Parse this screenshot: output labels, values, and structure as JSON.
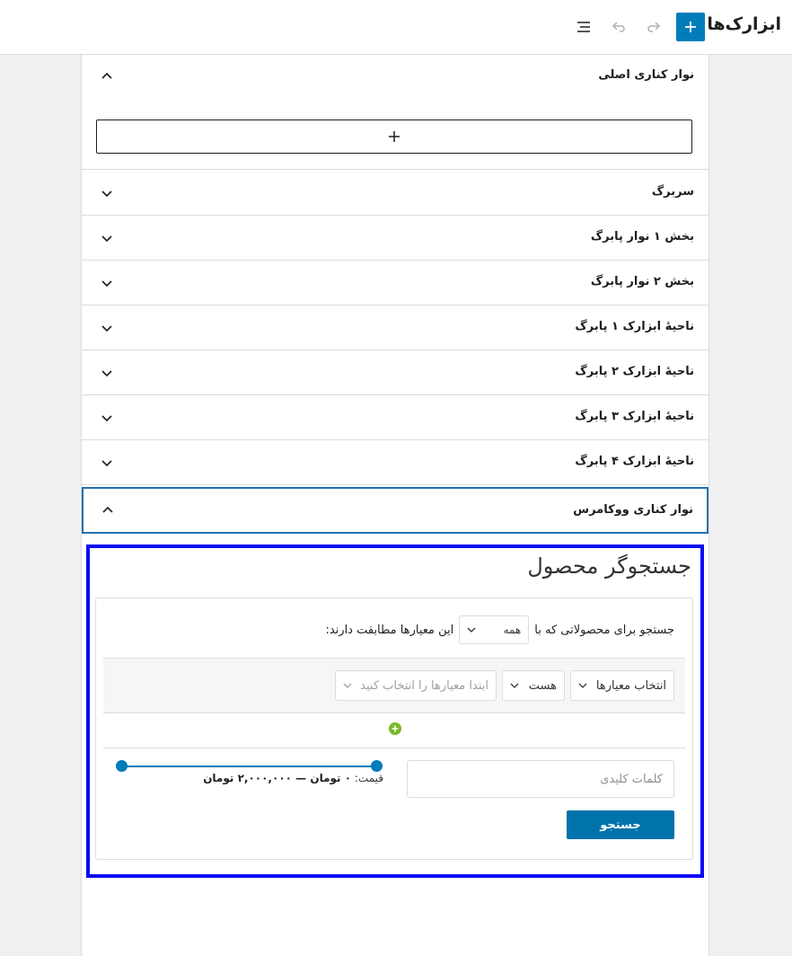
{
  "header": {
    "title": "ابزارک‌ها"
  },
  "sections": [
    {
      "label": "نوار کناری اصلی",
      "expanded": true
    },
    {
      "label": "سربرگ",
      "expanded": false
    },
    {
      "label": "بخش ۱ نوار پابرگ",
      "expanded": false
    },
    {
      "label": "بخش ۲ نوار پابرگ",
      "expanded": false
    },
    {
      "label": "ناحیهٔ ابزارک ۱ پابرگ",
      "expanded": false
    },
    {
      "label": "ناحیهٔ ابزارک ۲ پابرگ",
      "expanded": false
    },
    {
      "label": "ناحیهٔ ابزارک ۳ پابرگ",
      "expanded": false
    },
    {
      "label": "ناحیهٔ ابزارک ۴ پابرگ",
      "expanded": false
    },
    {
      "label": "نوار کناری ووکامرس",
      "expanded": true
    }
  ],
  "widget": {
    "title": "جستجوگر محصول",
    "query_prefix": "جستجو برای محصولاتی که با",
    "match_select": "همه",
    "query_suffix": "این معیارها مطابقت دارند:",
    "criteria": {
      "field_select": "انتخاب معیارها",
      "operator_select": "هست",
      "value_select": "ابتدا معیارها را انتخاب کنید"
    },
    "keywords_placeholder": "کلمات کلیدی",
    "price_label": "قیمت:",
    "price_range": "۰ تومان — ۲,۰۰۰,۰۰۰ تومان",
    "search_button": "جستجو"
  },
  "colors": {
    "accent": "#007cba",
    "highlight_border": "#0a0af5",
    "add_green": "#7ab828"
  }
}
